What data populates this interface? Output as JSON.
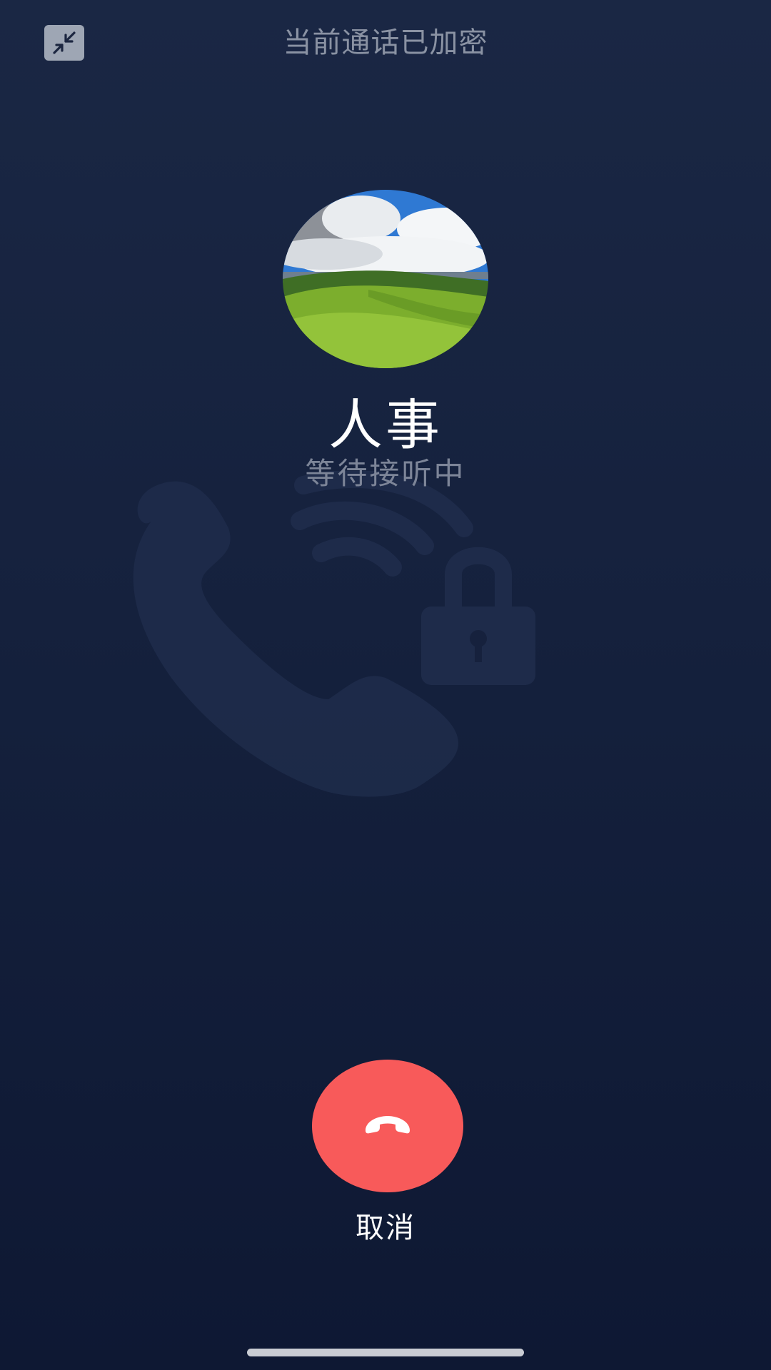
{
  "header": {
    "title": "当前通话已加密",
    "minimize_icon": "minimize-arrows-icon"
  },
  "contact": {
    "name": "人事",
    "status": "等待接听中",
    "avatar": "landscape-photo"
  },
  "background": {
    "watermark_icons": [
      "phone-icon",
      "signal-waves-icon",
      "lock-icon"
    ]
  },
  "actions": {
    "cancel_label": "取消",
    "cancel_icon": "hang-up-phone-icon",
    "cancel_color": "#f85a5a"
  },
  "colors": {
    "background_top": "#1a2744",
    "background_bottom": "#0e1833",
    "status_text": "#7d8598"
  }
}
